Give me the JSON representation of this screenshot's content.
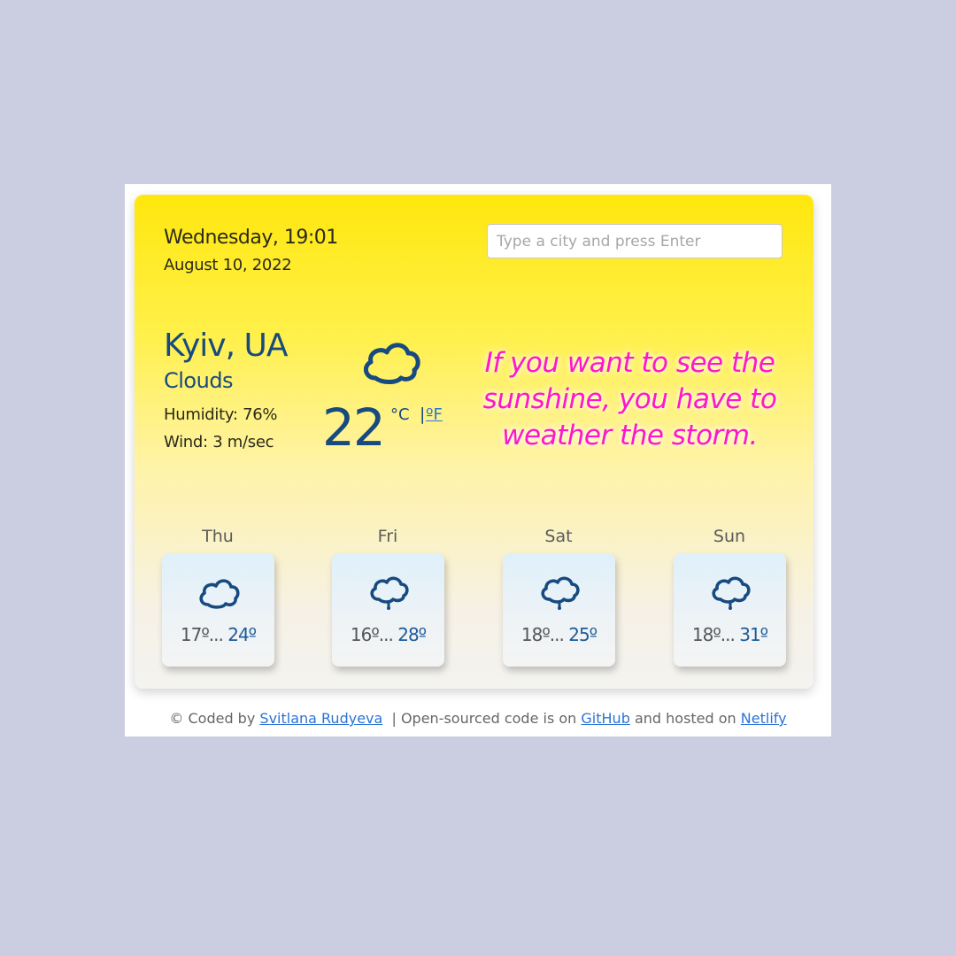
{
  "current": {
    "day_time": "Wednesday, 19:01",
    "date": "August 10, 2022",
    "city": "Kyiv, UA",
    "description": "Clouds",
    "humidity": "Humidity: 76%",
    "wind": "Wind: 3 m/sec",
    "temperature": "22",
    "unit_celsius": "°C",
    "unit_separator": "|",
    "unit_fahrenheit": "ºF",
    "icon": "cloud-icon"
  },
  "search": {
    "placeholder": "Type a city and press Enter",
    "value": ""
  },
  "quote": "If you want to see the sunshine, you have to weather the storm.",
  "forecast": [
    {
      "day": "Thu",
      "min": "17º...",
      "max": "24º",
      "icon": "cloud-icon"
    },
    {
      "day": "Fri",
      "min": "16º...",
      "max": "28º",
      "icon": "rain-cloud-icon"
    },
    {
      "day": "Sat",
      "min": "18º...",
      "max": "25º",
      "icon": "rain-cloud-icon"
    },
    {
      "day": "Sun",
      "min": "18º...",
      "max": "31º",
      "icon": "rain-cloud-icon"
    }
  ],
  "footer": {
    "prefix": "© Coded by",
    "author": "Svitlana Rudyeva",
    "middle": "| Open-sourced code is on",
    "github": "GitHub",
    "hosted": "and hosted on",
    "netlify": "Netlify"
  },
  "colors": {
    "background": "#cbcde1",
    "card_top": "#ffe70d",
    "card_bottom": "#f3f3f0",
    "primary_text": "#174a7f",
    "quote": "#ff17c7",
    "link": "#2b73d6"
  }
}
